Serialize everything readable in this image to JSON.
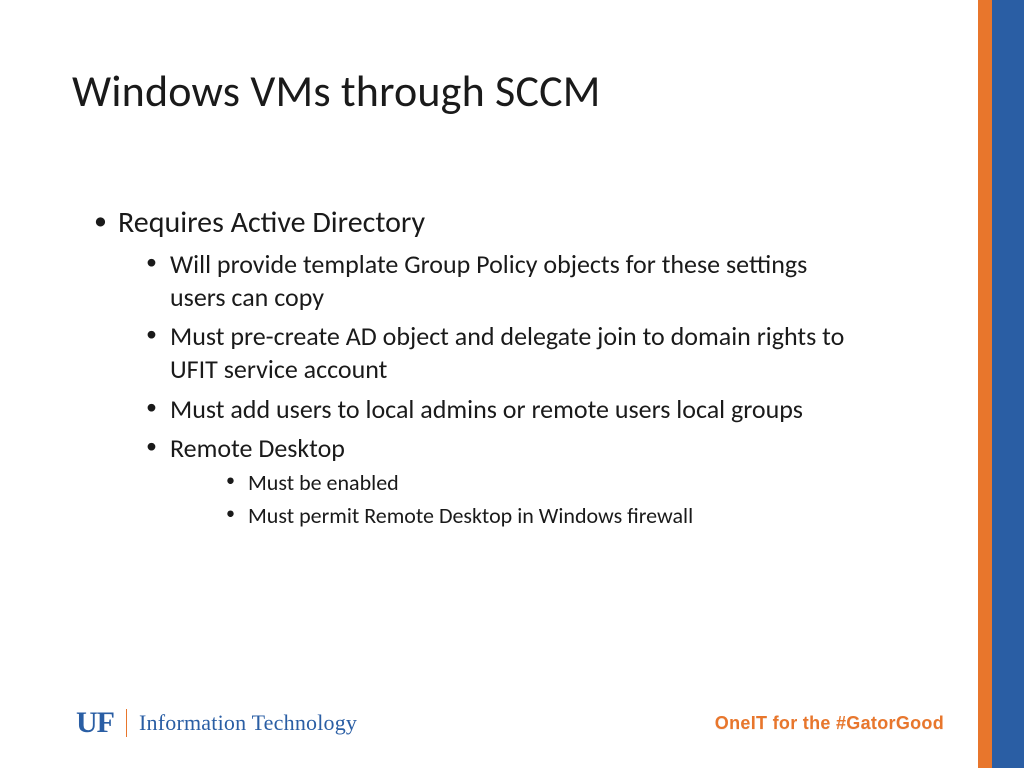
{
  "slide": {
    "title": "Windows VMs through SCCM",
    "bullets": {
      "item1": "Requires Active Directory",
      "sub1": "Will provide template Group Policy objects for these settings users can copy",
      "sub2": "Must pre-create AD object and delegate join to domain rights to UFIT service account",
      "sub3": "Must add users to local admins or remote users local groups",
      "sub4": "Remote Desktop",
      "subsub1": "Must be enabled",
      "subsub2": "Must permit Remote Desktop in Windows firewall"
    }
  },
  "footer": {
    "logo_mark": "UF",
    "logo_text": "Information Technology",
    "tagline": "OneIT for the #GatorGood"
  },
  "colors": {
    "orange": "#e8762c",
    "blue": "#2a5ea4"
  }
}
